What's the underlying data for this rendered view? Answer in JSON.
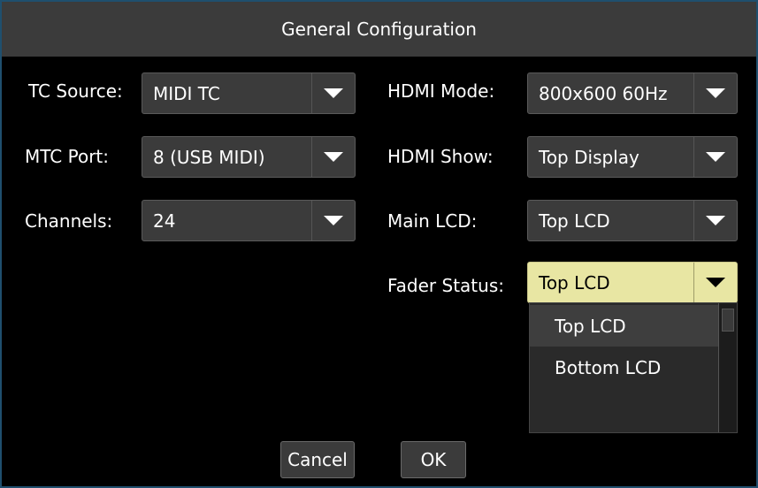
{
  "dialog": {
    "title": "General Configuration",
    "cancel_label": "Cancel",
    "ok_label": "OK"
  },
  "fields": {
    "tc_source": {
      "label": "TC Source:",
      "value": "MIDI TC"
    },
    "mtc_port": {
      "label": "MTC Port:",
      "value": "8 (USB MIDI)"
    },
    "channels": {
      "label": "Channels:",
      "value": "24"
    },
    "hdmi_mode": {
      "label": "HDMI Mode:",
      "value": "800x600 60Hz"
    },
    "hdmi_show": {
      "label": "HDMI Show:",
      "value": "Top Display"
    },
    "main_lcd": {
      "label": "Main LCD:",
      "value": "Top LCD"
    },
    "fader_status": {
      "label": "Fader Status:",
      "value": "Top LCD",
      "options": [
        "Top LCD",
        "Bottom LCD"
      ]
    }
  },
  "colors": {
    "active_dropdown": "#e8e6a3",
    "dialog_border": "#1f4f6e"
  },
  "icons": {
    "dropdown_arrow": "chevron-down-icon"
  }
}
